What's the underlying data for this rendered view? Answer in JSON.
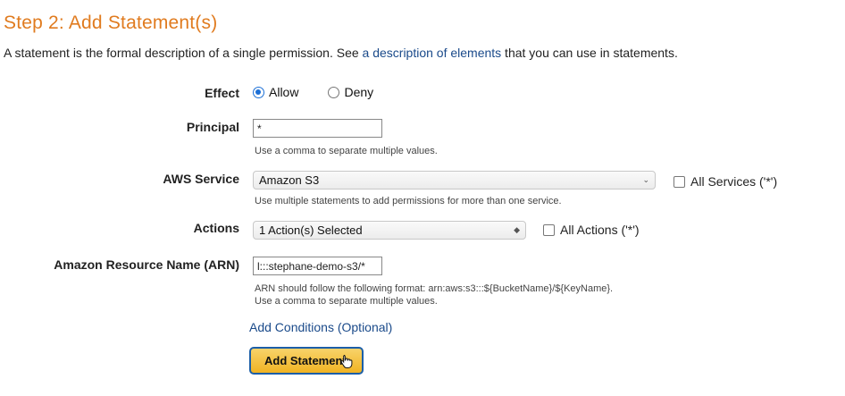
{
  "header": {
    "title": "Step 2: Add Statement(s)",
    "intro_before": "A statement is the formal description of a single permission. See ",
    "intro_link": "a description of elements",
    "intro_after": " that you can use in statements."
  },
  "effect": {
    "label": "Effect",
    "options": [
      "Allow",
      "Deny"
    ],
    "selected": "Allow"
  },
  "principal": {
    "label": "Principal",
    "value": "*",
    "hint": "Use a comma to separate multiple values."
  },
  "aws_service": {
    "label": "AWS Service",
    "selected": "Amazon S3",
    "all_label": "All Services ('*')",
    "hint": "Use multiple statements to add permissions for more than one service."
  },
  "actions": {
    "label": "Actions",
    "selected": "1 Action(s) Selected",
    "all_label": "All Actions ('*')"
  },
  "arn": {
    "label": "Amazon Resource Name (ARN)",
    "value": "l:::stephane-demo-s3/*",
    "hint_line1": "ARN should follow the following format: arn:aws:s3:::${BucketName}/${KeyName}.",
    "hint_line2": "Use a comma to separate multiple values."
  },
  "conditions": {
    "link": "Add Conditions (Optional)"
  },
  "submit": {
    "label": "Add Statement"
  },
  "colors": {
    "title": "#e07b1f",
    "link": "#1a4a8a",
    "button": "#f0b323",
    "radio_accent": "#1b6fd6"
  }
}
